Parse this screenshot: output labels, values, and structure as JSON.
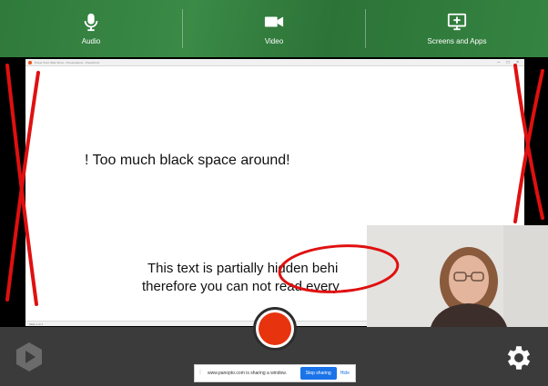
{
  "toolbar": {
    "audio_label": "Audio",
    "video_label": "Video",
    "screens_label": "Screens and Apps"
  },
  "window": {
    "title": "Power Point Slide Show - Presentation1 - PowerPoint",
    "controls": "– □ ×"
  },
  "slide": {
    "line1": "! Too much black space around!",
    "line2": "This text is partially hidden behi",
    "line3": "therefore you can not read every",
    "status": "Slide 1 of 1"
  },
  "share_banner": {
    "handle": "⁞",
    "text": "www.panopto.com is sharing a window.",
    "stop_label": "Stop sharing",
    "hide_label": "Hide"
  },
  "icons": {
    "audio": "microphone-icon",
    "video": "video-camera-icon",
    "screens": "screen-share-icon",
    "logo": "panopto-logo-icon",
    "settings": "gear-icon"
  },
  "colors": {
    "toolbar_green": "#2f7a3c",
    "record_red": "#e8330f",
    "annotation_red": "#e01010",
    "stop_blue": "#1a73e8"
  }
}
